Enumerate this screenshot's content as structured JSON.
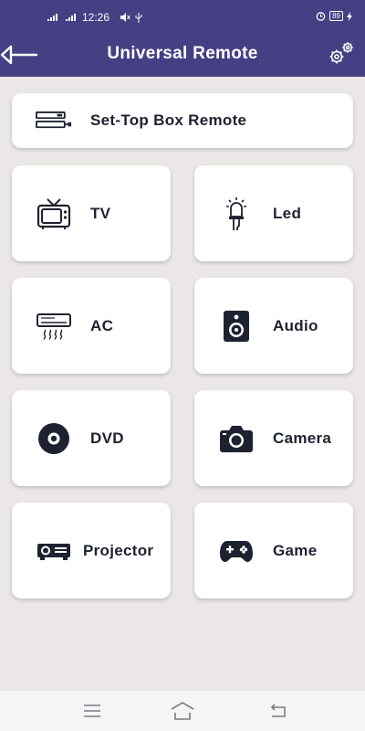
{
  "status_bar": {
    "time": "12:26",
    "battery": "89"
  },
  "app_bar": {
    "title": "Universal Remote"
  },
  "remotes": {
    "set_top_box": "Set-Top Box Remote",
    "tv": "TV",
    "led": "Led",
    "ac": "AC",
    "audio": "Audio",
    "dvd": "DVD",
    "camera": "Camera",
    "projector": "Projector",
    "game": "Game"
  },
  "colors": {
    "header": "#453f84",
    "background": "#ebe7e6",
    "card": "#ffffff",
    "icon": "#1e2230"
  },
  "icons": [
    "back-arrow-icon",
    "settings-gears-icon",
    "set-top-box-icon",
    "tv-icon",
    "led-icon",
    "ac-icon",
    "speaker-icon",
    "disc-icon",
    "camera-icon",
    "projector-icon",
    "gamepad-icon"
  ]
}
